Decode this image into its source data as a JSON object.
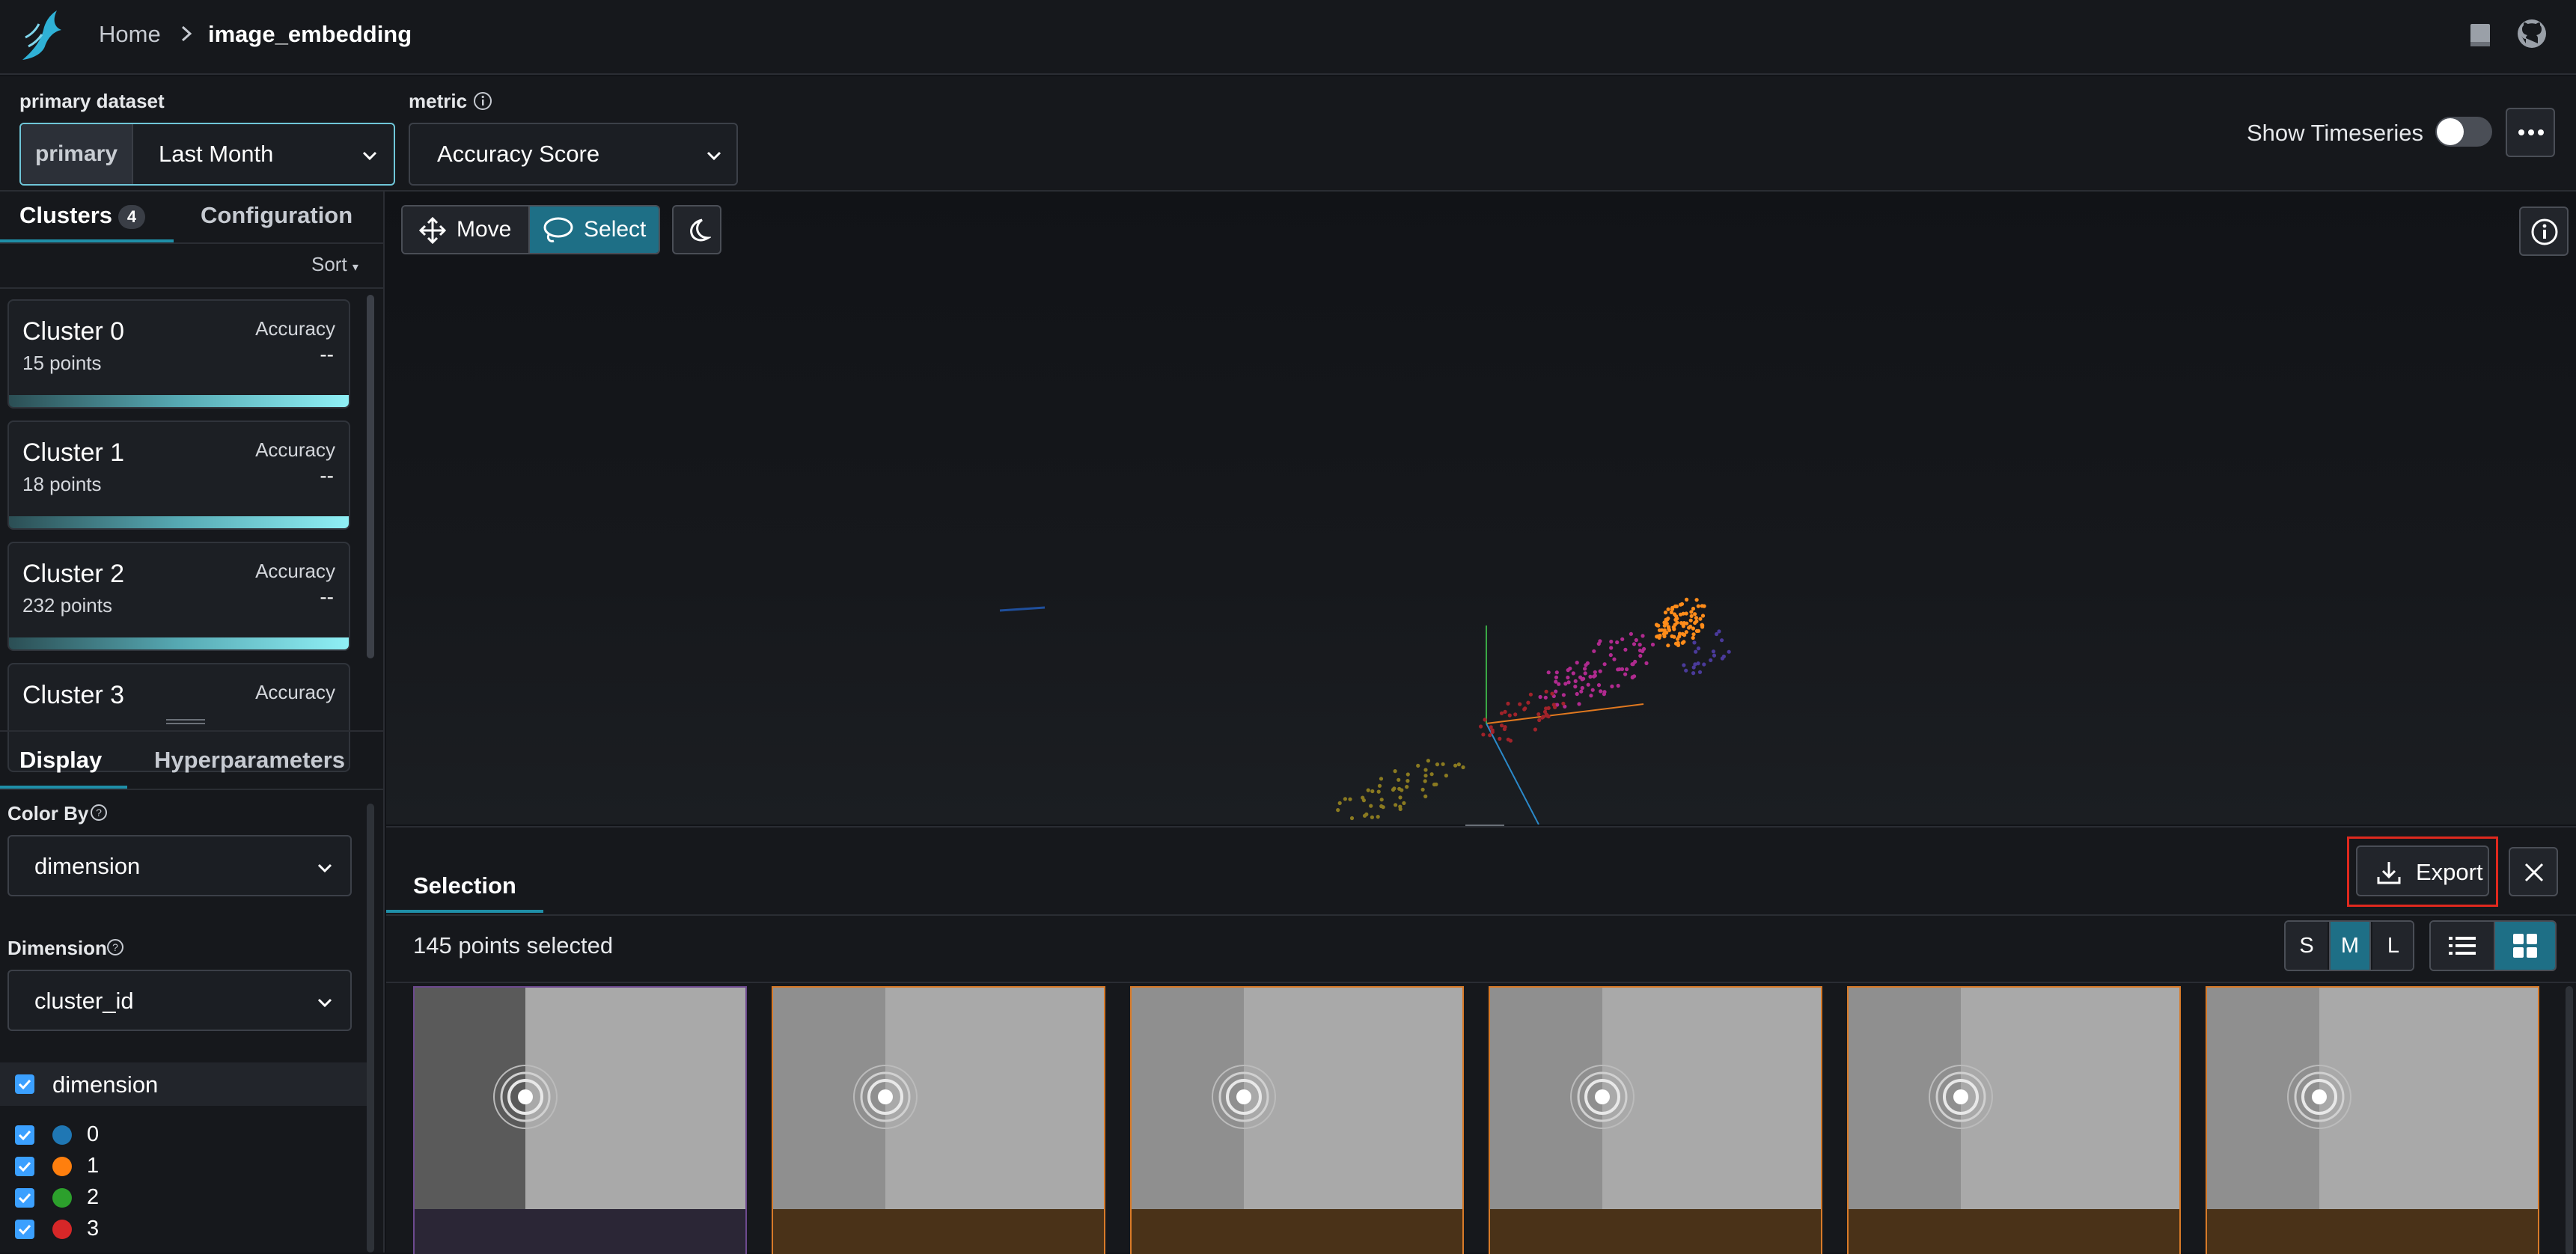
{
  "breadcrumb": {
    "home": "Home",
    "current": "image_embedding"
  },
  "controls": {
    "primary_dataset_label": "primary dataset",
    "primary_badge": "primary",
    "primary_value": "Last Month",
    "metric_label": "metric",
    "metric_value": "Accuracy Score",
    "show_timeseries_label": "Show Timeseries",
    "show_timeseries_on": false
  },
  "left_panel": {
    "tabs": {
      "clusters": "Clusters",
      "clusters_count": "4",
      "configuration": "Configuration"
    },
    "sort_label": "Sort",
    "clusters": [
      {
        "name": "Cluster 0",
        "points": "15 points",
        "metric_label": "Accuracy",
        "metric_value": "--"
      },
      {
        "name": "Cluster 1",
        "points": "18 points",
        "metric_label": "Accuracy",
        "metric_value": "--"
      },
      {
        "name": "Cluster 2",
        "points": "232 points",
        "metric_label": "Accuracy",
        "metric_value": "--"
      },
      {
        "name": "Cluster 3",
        "points": "",
        "metric_label": "Accuracy",
        "metric_value": ""
      }
    ],
    "display_tabs": {
      "display": "Display",
      "hyperparameters": "Hyperparameters"
    },
    "color_by_label": "Color By",
    "color_by_value": "dimension",
    "dimension_label": "Dimension",
    "dimension_value": "cluster_id",
    "legend_header": "dimension",
    "legend": [
      {
        "label": "0",
        "color": "#1f77b4"
      },
      {
        "label": "1",
        "color": "#ff7f0e"
      },
      {
        "label": "2",
        "color": "#2ca02c"
      },
      {
        "label": "3",
        "color": "#d62728"
      }
    ]
  },
  "canvas": {
    "move_label": "Move",
    "select_label": "Select",
    "active_tool": "select"
  },
  "selection": {
    "tab_label": "Selection",
    "export_label": "Export",
    "count_text": "145 points selected",
    "sizes": [
      "S",
      "M",
      "L"
    ],
    "active_size": "M",
    "active_view": "grid",
    "thumbnails": 6
  },
  "colors": {
    "accent": "#1f8fa8",
    "export_highlight": "#e0291e",
    "thumb_border": "#d87a28"
  }
}
